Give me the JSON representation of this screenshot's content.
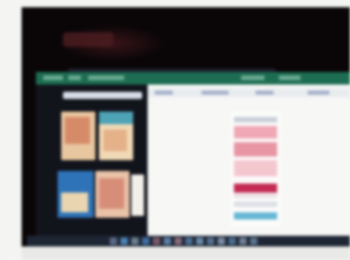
{
  "photo": {
    "subject": "",
    "visible_text": []
  },
  "colors": {
    "bezel": "#0a0608",
    "nav_bar": "#1d6d52",
    "side_panel": "#12141c",
    "main_panel": "#f7f7f5",
    "accent_red": "#c42a52",
    "accent_blue": "#2e73b8",
    "taskbar": "#1e2634"
  },
  "icons": [
    "app-thumbnail",
    "taskbar-app-icon"
  ]
}
